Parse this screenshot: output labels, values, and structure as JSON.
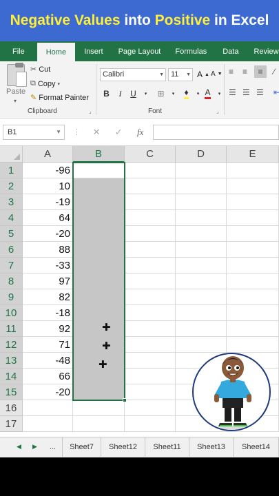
{
  "banner": {
    "parts": [
      {
        "text": "Negative Values",
        "color": "#ffef3a"
      },
      {
        "text": " into ",
        "color": "#ffffff"
      },
      {
        "text": "Positive",
        "color": "#ffef3a"
      },
      {
        "text": " in Excel",
        "color": "#ffffff"
      }
    ]
  },
  "ribbon_tabs": [
    "File",
    "Home",
    "Insert",
    "Page Layout",
    "Formulas",
    "Data",
    "Review"
  ],
  "active_tab": "Home",
  "clipboard": {
    "paste_label": "Paste",
    "cut_label": "Cut",
    "copy_label": "Copy",
    "format_painter_label": "Format Painter",
    "group_label": "Clipboard"
  },
  "font": {
    "font_name": "Calibri",
    "font_size": "11",
    "bold": "B",
    "italic": "I",
    "underline": "U",
    "group_label": "Font"
  },
  "formula_bar": {
    "name_box": "B1",
    "fx": "fx",
    "formula": ""
  },
  "columns": [
    "A",
    "B",
    "C",
    "D",
    "E"
  ],
  "selected_column": "B",
  "rows": [
    {
      "num": "1",
      "a": "-96"
    },
    {
      "num": "2",
      "a": "10"
    },
    {
      "num": "3",
      "a": "-19"
    },
    {
      "num": "4",
      "a": "64"
    },
    {
      "num": "5",
      "a": "-20"
    },
    {
      "num": "6",
      "a": "88"
    },
    {
      "num": "7",
      "a": "-33"
    },
    {
      "num": "8",
      "a": "97"
    },
    {
      "num": "9",
      "a": "82"
    },
    {
      "num": "10",
      "a": "-18"
    },
    {
      "num": "11",
      "a": "92"
    },
    {
      "num": "12",
      "a": "71"
    },
    {
      "num": "13",
      "a": "-48"
    },
    {
      "num": "14",
      "a": "66"
    },
    {
      "num": "15",
      "a": "-20"
    },
    {
      "num": "16",
      "a": ""
    },
    {
      "num": "17",
      "a": ""
    }
  ],
  "sheet_tabs": [
    "...",
    "Sheet7",
    "Sheet12",
    "Sheet11",
    "Sheet13",
    "Sheet14"
  ],
  "colors": {
    "excel_green": "#217346",
    "banner_blue": "#3d6ad0",
    "highlight_yellow": "#ffef3a",
    "selection_gray": "#c6c6c6"
  }
}
